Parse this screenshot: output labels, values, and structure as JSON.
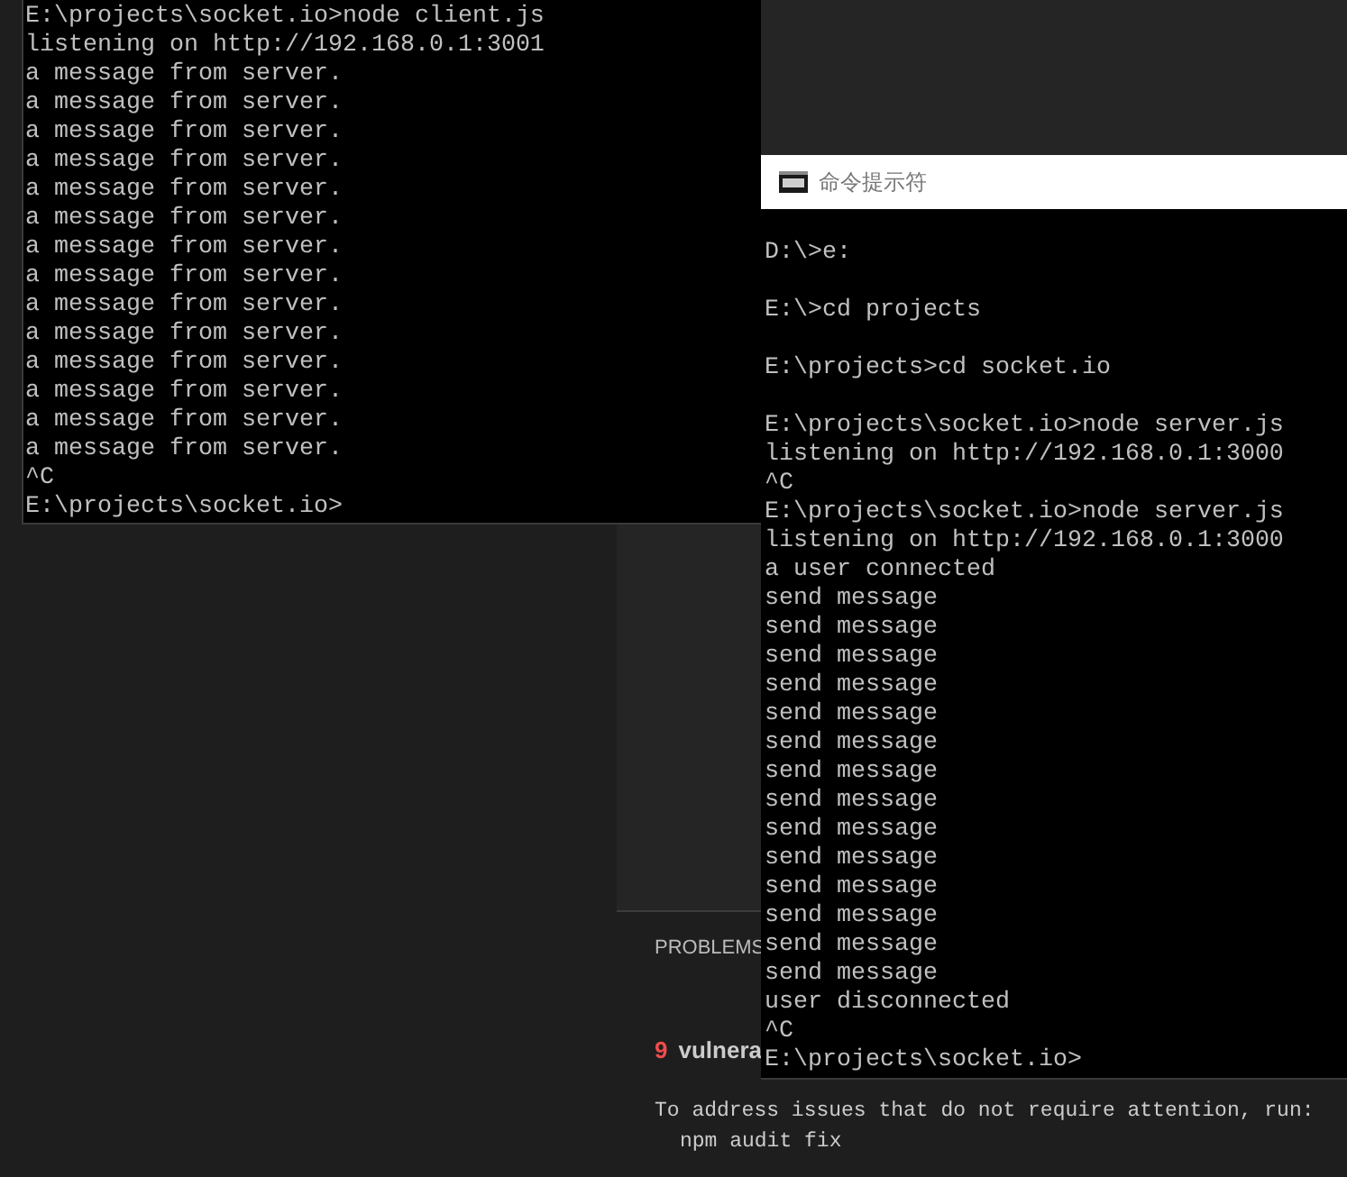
{
  "client_console": {
    "lines": [
      "E:\\projects\\socket.io>node client.js",
      "listening on http://192.168.0.1:3001",
      "a message from server.",
      "a message from server.",
      "a message from server.",
      "a message from server.",
      "a message from server.",
      "a message from server.",
      "a message from server.",
      "a message from server.",
      "a message from server.",
      "a message from server.",
      "a message from server.",
      "a message from server.",
      "a message from server.",
      "a message from server.",
      "^C",
      "E:\\projects\\socket.io>"
    ]
  },
  "server_console": {
    "title": "命令提示符",
    "blocks": [
      [
        "D:\\>e:"
      ],
      [
        "E:\\>cd projects"
      ],
      [
        "E:\\projects>cd socket.io"
      ],
      [
        "E:\\projects\\socket.io>node server.js",
        "listening on http://192.168.0.1:3000",
        "^C",
        "E:\\projects\\socket.io>node server.js",
        "listening on http://192.168.0.1:3000",
        "a user connected",
        "send message",
        "send message",
        "send message",
        "send message",
        "send message",
        "send message",
        "send message",
        "send message",
        "send message",
        "send message",
        "send message",
        "send message",
        "send message",
        "send message",
        "user disconnected",
        "^C",
        "E:\\projects\\socket.io>"
      ]
    ]
  },
  "editor_panel": {
    "tab": "PROBLEMS",
    "count": "9",
    "count_label": "vulnera",
    "message": [
      "To address issues that do not require attention, run:",
      "npm audit fix"
    ]
  }
}
